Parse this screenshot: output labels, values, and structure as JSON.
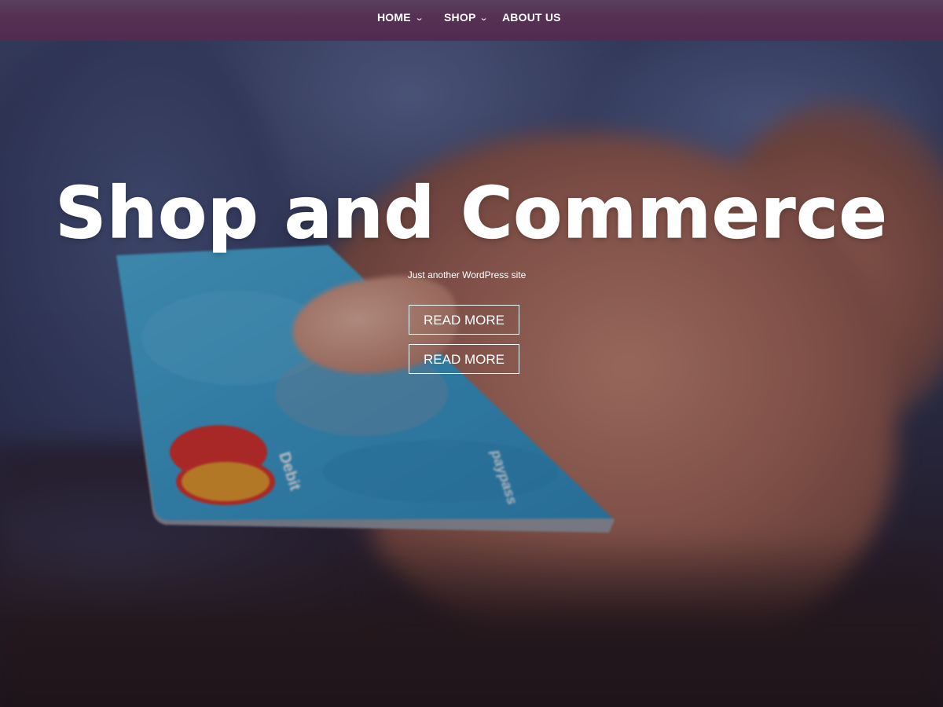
{
  "nav": {
    "items": [
      {
        "label": "HOME",
        "has_dropdown": true,
        "chevron": "⌄"
      },
      {
        "label": "SHOP",
        "has_dropdown": true,
        "chevron": "⌄"
      },
      {
        "label": "ABOUT US",
        "has_dropdown": false,
        "chevron": ""
      }
    ]
  },
  "hero": {
    "title": "Shop and Commerce",
    "tagline": "Just another WordPress site",
    "buttons": [
      {
        "label": "READ MORE"
      },
      {
        "label": "READ MORE"
      }
    ],
    "background_image": {
      "card_text_brand": "Debit",
      "card_text_other": "paypass"
    }
  },
  "colors": {
    "nav_background": "#542c52",
    "text": "#ffffff",
    "card_blue": "#3aa6d6",
    "mastercard_red": "#e0322b",
    "mastercard_orange": "#f0a12a"
  }
}
